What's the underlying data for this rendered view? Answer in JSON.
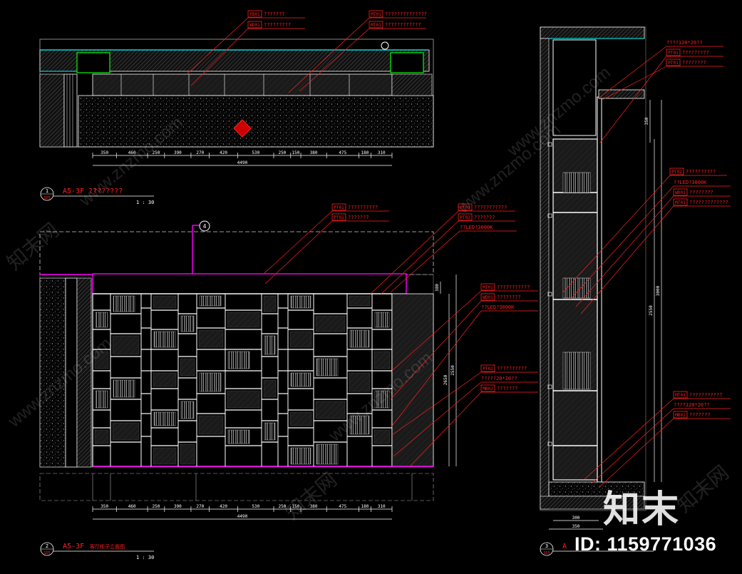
{
  "drawing": {
    "background": "#000000",
    "line_color": "#ffffff",
    "annotation_color": "#ff2020",
    "accent_cyan": "#00ffff",
    "accent_green": "#00ff00",
    "accent_magenta": "#ff00ff"
  },
  "views": [
    {
      "number": "1",
      "sheet": "SD5",
      "title": "A5-3F ????????",
      "scale": "1 : 30",
      "dimensions": [
        "350",
        "460",
        "250",
        "390",
        "270",
        "420",
        "530",
        "250",
        "150",
        "380",
        "475",
        "180",
        "310"
      ],
      "total": "4490",
      "tags": [
        {
          "code": "FB01",
          "text": "???????"
        },
        {
          "code": "WD01",
          "text": "?????????"
        },
        {
          "code": "MT01",
          "text": "??????????????"
        },
        {
          "code": "MT01",
          "text": "????????????"
        }
      ]
    },
    {
      "number": "2",
      "sheet": "SD5",
      "title": "A5-3F",
      "title_suffix": "客厅柜子立面图",
      "scale": "1 : 30",
      "section_marker": "4",
      "dimensions": [
        "350",
        "460",
        "250",
        "390",
        "270",
        "420",
        "530",
        "250",
        "150",
        "380",
        "475",
        "180",
        "310"
      ],
      "total": "4490",
      "heights": [
        "380",
        "2650",
        "2550"
      ],
      "tags": [
        {
          "code": "PT01",
          "text": "??????????"
        },
        {
          "code": "PT01",
          "text": "???????"
        },
        {
          "code": "MT01",
          "text": "???????????"
        },
        {
          "code": "PT02",
          "text": "???????"
        },
        {
          "code": "",
          "text": "??LED?3000K"
        },
        {
          "code": "MT01",
          "text": "???????????"
        },
        {
          "code": "WD01",
          "text": "????????"
        },
        {
          "code": "",
          "text": "??LED?3000K"
        },
        {
          "code": "PT02",
          "text": "??????????"
        },
        {
          "code": "",
          "text": "?????20*20??"
        },
        {
          "code": "MB02",
          "text": "???????"
        }
      ]
    },
    {
      "number": "3",
      "sheet": "SD5",
      "title": "A",
      "dimensions": [
        "300",
        "350"
      ],
      "heights": [
        "350",
        "2550",
        "3000"
      ],
      "tags": [
        {
          "code": "",
          "text": "????120*20??"
        },
        {
          "code": "PT01",
          "text": "?????????"
        },
        {
          "code": "PT01",
          "text": "????????"
        },
        {
          "code": "PT02",
          "text": "??????????"
        },
        {
          "code": "",
          "text": "??LED?3000K"
        },
        {
          "code": "WD01",
          "text": "????????"
        },
        {
          "code": "MT01",
          "text": "?????????????"
        },
        {
          "code": "MT01",
          "text": "???????????"
        },
        {
          "code": "",
          "text": "????120*20??"
        },
        {
          "code": "MB02",
          "text": "???????"
        }
      ]
    }
  ],
  "watermark": {
    "logo": "知末",
    "id": "ID: 1159771036",
    "site": "www.znzmo.com",
    "brand": "知末网"
  }
}
